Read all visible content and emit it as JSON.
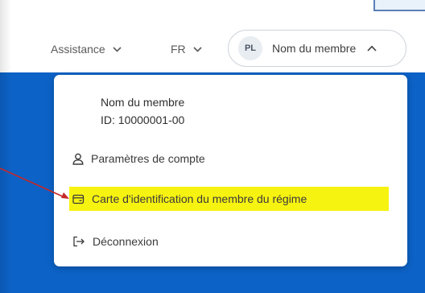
{
  "header": {
    "assistance_label": "Assistance",
    "language_label": "FR",
    "user": {
      "initials": "PL",
      "name": "Nom du membre"
    }
  },
  "dropdown": {
    "member_name": "Nom du membre",
    "member_id": "ID: 10000001-00",
    "items": [
      {
        "label": "Paramètres de compte",
        "icon": "user-icon"
      },
      {
        "label": "Carte d'identification du membre du régime",
        "icon": "id-card-icon",
        "highlighted": true
      },
      {
        "label": "Déconnexion",
        "icon": "logout-icon"
      }
    ]
  },
  "colors": {
    "brand_blue": "#0c62c6",
    "highlight_yellow": "#f7f311",
    "annotation_arrow": "#c62828"
  }
}
